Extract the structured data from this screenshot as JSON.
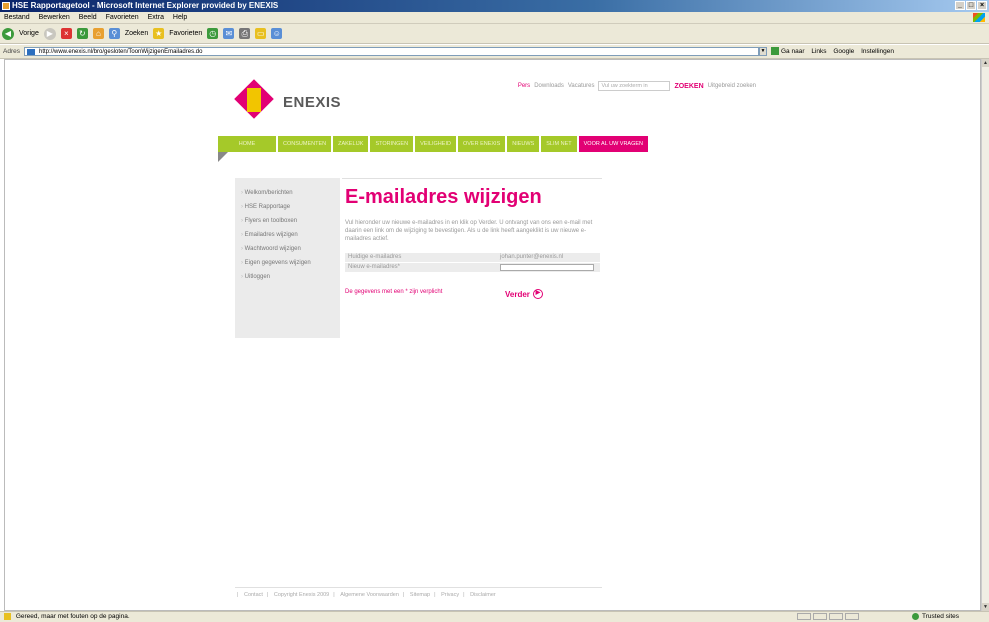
{
  "window": {
    "title": "HSE Rapportagetool - Microsoft Internet Explorer provided by ENEXIS",
    "controls": [
      "_",
      "□",
      "×"
    ]
  },
  "menu": [
    "Bestand",
    "Bewerken",
    "Beeld",
    "Favorieten",
    "Extra",
    "Help"
  ],
  "toolbar": {
    "back_label": "Vorige",
    "search_label": "Zoeken",
    "favorites_label": "Favorieten"
  },
  "address": {
    "label": "Adres",
    "url": "http://www.enexis.nl/bro/gesloten/ToonWijzigenEmailadres.do",
    "go_label": "Ga naar",
    "links_label": "Links",
    "google_label": "Google",
    "settings_label": "Instellingen"
  },
  "site": {
    "logo_text": "ENEXIS",
    "toplinks": {
      "pers": "Pers",
      "downloads": "Downloads",
      "vacatures": "Vacatures",
      "search_placeholder": "Vul uw zoekterm in",
      "search_button": "ZOEKEN",
      "advanced": "Uitgebreid zoeken"
    },
    "nav": [
      "HOME",
      "CONSUMENTEN",
      "ZAKELIJK",
      "STORINGEN",
      "VEILIGHEID",
      "OVER ENEXIS",
      "NIEUWS",
      "SLIM NET",
      "VOOR AL UW VRAGEN"
    ],
    "sidebar": [
      "Welkom/berichten",
      "HSE Rapportage",
      "Flyers en toolboxen",
      "Emailadres wijzigen",
      "Wachtwoord wijzigen",
      "Eigen gegevens wijzigen",
      "Uitloggen"
    ],
    "main": {
      "title": "E-mailadres wijzigen",
      "intro": "Vul hieronder uw nieuwe e-mailadres in en klik op Verder. U ontvangt van ons een e-mail met daarin een link om de wijziging te bevestigen. Als u de link heeft aangeklikt is uw nieuwe e-mailadres actief.",
      "current_label": "Huidige e-mailadres",
      "current_value": "johan.punter@enexis.nl",
      "new_label": "Nieuw e-mailadres*",
      "required_note": "De gegevens met een * zijn verplicht",
      "submit_label": "Verder"
    },
    "footer": [
      "Contact",
      "Copyright Enexis 2009",
      "Algemene Voorwaarden",
      "Sitemap",
      "Privacy",
      "Disclaimer"
    ]
  },
  "status": {
    "text": "Gereed, maar met fouten op de pagina.",
    "zone": "Trusted sites"
  }
}
